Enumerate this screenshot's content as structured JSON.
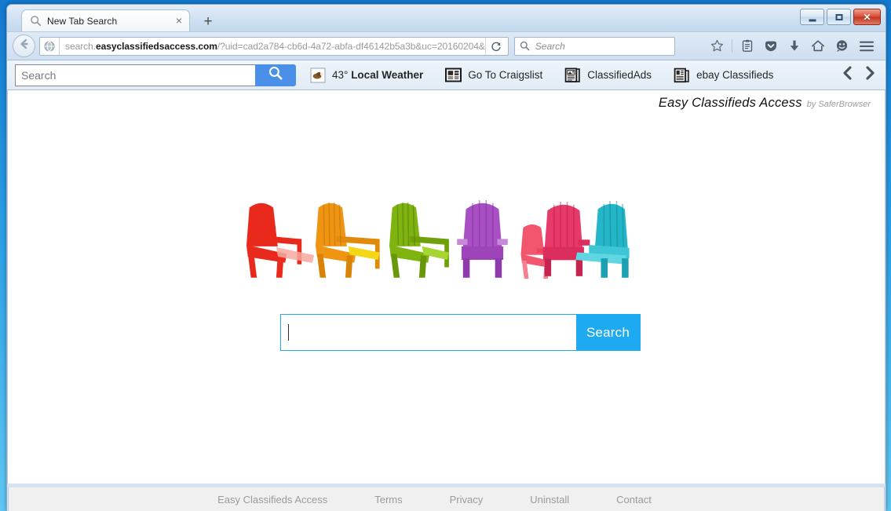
{
  "window": {
    "controls": {
      "minimize": "–",
      "maximize": "□",
      "close": "✕"
    }
  },
  "tabs": {
    "active": {
      "title": "New Tab Search",
      "favicon": "search-icon",
      "close_label": "×"
    },
    "new_tab_label": "+"
  },
  "navbar": {
    "back_icon": "back-arrow-icon",
    "identity_icon": "globe-icon",
    "url_prefix": "search.",
    "url_domain": "easyclassifiedsaccess.com",
    "url_path": "/?uid=cad2a784-cb6d-4a72-abfa-df46142b5a3b&uc=20160204&",
    "reload_icon": "reload-icon",
    "search_placeholder": "Search",
    "icons": [
      {
        "name": "bookmark-star-icon"
      },
      {
        "name": "reading-list-icon"
      },
      {
        "name": "pocket-icon"
      },
      {
        "name": "downloads-icon"
      },
      {
        "name": "home-icon"
      },
      {
        "name": "sync-smiley-icon"
      },
      {
        "name": "hamburger-menu-icon"
      }
    ]
  },
  "ext_toolbar": {
    "search_placeholder": "Search",
    "search_button_icon": "search-icon",
    "items": [
      {
        "name": "local-weather",
        "icon": "weather-icon",
        "temp": "43°",
        "label": "Local Weather"
      },
      {
        "name": "go-to-craigslist",
        "icon": "newspaper-icon",
        "label": "Go To Craigslist"
      },
      {
        "name": "classified-ads",
        "icon": "classified-ads-icon",
        "label": "ClassifiedAds"
      },
      {
        "name": "ebay-classifieds",
        "icon": "ebay-classifieds-icon",
        "label": "ebay Classifieds"
      }
    ],
    "nav_prev": "‹",
    "nav_next": "›"
  },
  "page": {
    "brand_name": "Easy Classifieds Access",
    "brand_by": "by SaferBrowser",
    "logo": {
      "name": "colorful-adirondack-chairs-logo",
      "chair_colors": [
        "#e8291c",
        "#ef9512",
        "#7fb410",
        "#a94fc4",
        "#e8396b",
        "#23b6c8"
      ]
    },
    "search": {
      "value": "",
      "placeholder": "",
      "button_label": "Search",
      "accent_color": "#1eaaf1"
    },
    "footer_links": [
      "Easy Classifieds Access",
      "Terms",
      "Privacy",
      "Uninstall",
      "Contact"
    ]
  }
}
